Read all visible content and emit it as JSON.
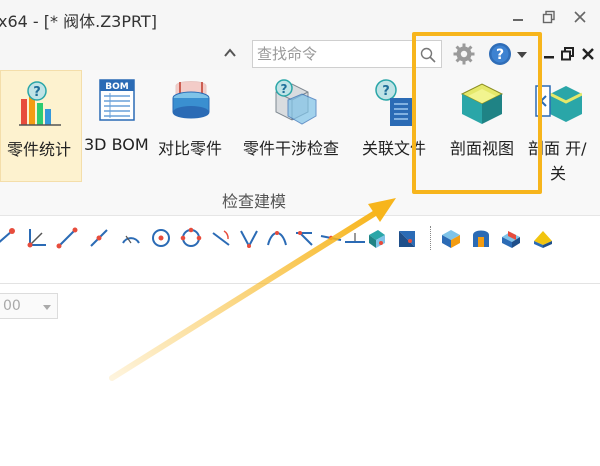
{
  "window": {
    "title": "x64 - [* 阀体.Z3PRT]"
  },
  "titlebar": {
    "minimize_icon": "minimize-icon",
    "restore_icon": "restore-icon",
    "close_icon": "close-icon"
  },
  "commandbar": {
    "search_placeholder": "查找命令",
    "icons": [
      "collapse-ribbon-icon",
      "search-icon",
      "gear-icon",
      "help-icon",
      "dropdown-arrow-icon",
      "mdi-minimize-icon",
      "mdi-restore-icon",
      "mdi-close-icon"
    ]
  },
  "ribbon": {
    "items": [
      {
        "label": "零件统计",
        "icon": "part-statistics-icon"
      },
      {
        "label": "3D BOM",
        "icon": "bom-icon"
      },
      {
        "label": "对比零件",
        "icon": "compare-parts-icon"
      },
      {
        "label": "零件干涉检查",
        "icon": "interference-check-icon"
      },
      {
        "label": "关联文件",
        "icon": "linked-file-icon"
      },
      {
        "label": "剖面视图",
        "icon": "section-view-icon"
      },
      {
        "label_line1": "剖面 开/",
        "label_line2": "关",
        "icon": "section-toggle-icon"
      }
    ],
    "group_label": "检查建模"
  },
  "toolbar": {
    "icons": [
      "point-icon",
      "axis-icon",
      "line-icon",
      "line-icon",
      "line-icon",
      "arc-icon",
      "circle-icon",
      "circle-icon",
      "angle-icon",
      "angle-icon",
      "curve-icon",
      "angle-icon",
      "line-icon",
      "line-icon",
      "plane-icon",
      "plane-icon",
      "solid-icon",
      "solid-icon",
      "solid-icon",
      "solid-icon"
    ],
    "overflow_icon": "toolbar-overflow-icon"
  },
  "document": {
    "zoom_value": "00"
  },
  "colors": {
    "highlight": "#f7b51c",
    "ribbon_selected_bg": "#fdf2cf",
    "bom_blue": "#2b6bb5",
    "icon_teal": "#2aa6a8"
  }
}
